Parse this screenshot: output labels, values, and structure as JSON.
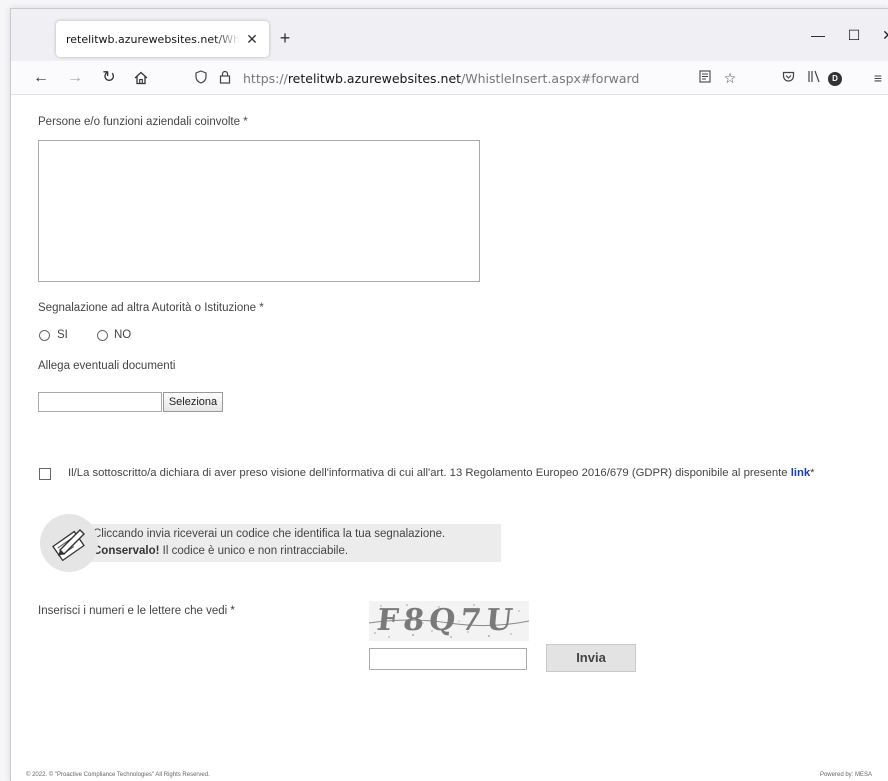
{
  "browser": {
    "tab_title": "retelitwb.azurewebsites.net/WhistleInsert.aspx#forward",
    "tab_close": "✕",
    "new_tab": "+",
    "url_scheme": "https://",
    "url_host": "retelitwb.azurewebsites.net",
    "url_path": "/WhistleInsert.aspx#forward",
    "profile_initial": "D",
    "icons": [
      "back-icon",
      "forward-icon",
      "reload-icon",
      "home-icon",
      "shield-icon",
      "lock-icon",
      "reader-icon",
      "star-icon",
      "pocket-icon",
      "library-icon",
      "menu-icon"
    ]
  },
  "form": {
    "persone_label": "Persone e/o funzioni aziendali coinvolte *",
    "segnalazione_label": "Segnalazione ad altra Autorità o Istituzione *",
    "radio_si": "SI",
    "radio_no": "NO",
    "allega_label": "Allega eventuali documenti",
    "seleziona_button": "Seleziona",
    "gdpr_text": "Il/La sottoscritto/a dichiara di aver preso visione dell'informativa di cui all'art. 13 Regolamento Europeo 2016/679 (GDPR) disponibile al presente ",
    "gdpr_link": "link",
    "gdpr_required": "*",
    "info_line1": "Cliccando invia riceverai un codice che identifica la tua segnalazione.",
    "info_bold": "Conservalo!",
    "info_line2_rest": " Il codice è unico e non rintracciabile.",
    "captcha_label": "Inserisci i numeri e le lettere che vedi *",
    "captcha_text": "F8Q7U",
    "invia_button": "Invia"
  },
  "footer": {
    "copyright": "© 2022. © \"Proactive Compliance Technologies\" All Rights Reserved.",
    "powered": "Powered by: MESA"
  },
  "colors": {
    "link": "#1a3cb8",
    "info_bg": "#ececec",
    "button_bg": "#e3e3e3"
  }
}
